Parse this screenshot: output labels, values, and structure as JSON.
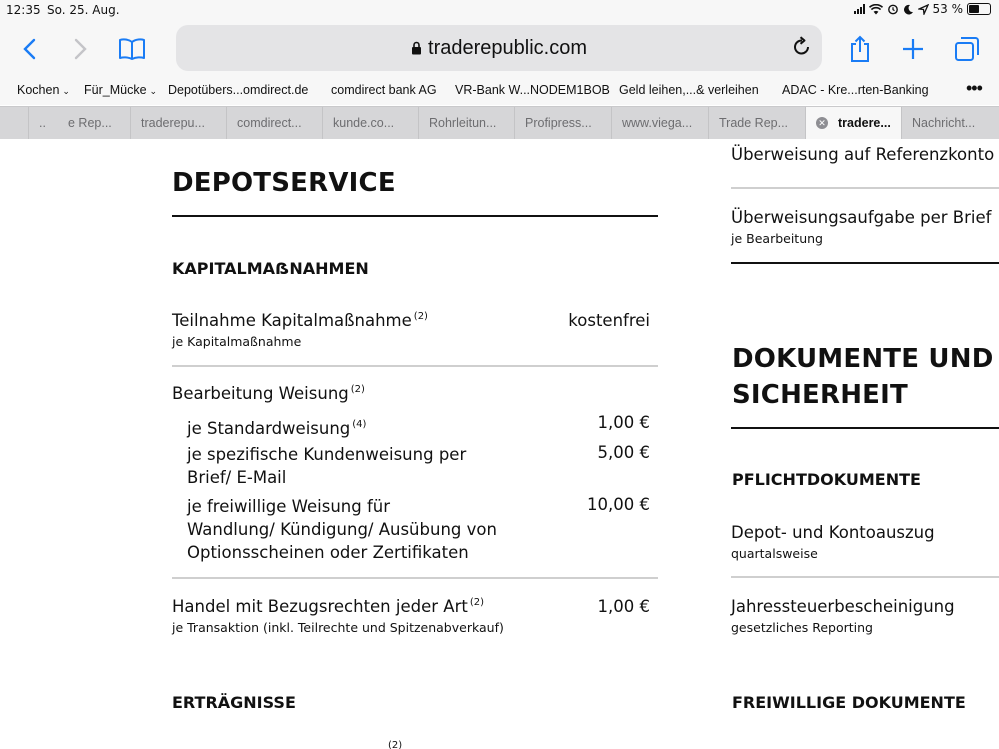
{
  "status_bar": {
    "time": "12:35",
    "date": "So. 25. Aug.",
    "battery": "53 %"
  },
  "toolbar": {
    "url": "traderepublic.com"
  },
  "bookmarks": [
    {
      "label": "Kochen",
      "folder": true
    },
    {
      "label": "Für_Mücke",
      "folder": true
    },
    {
      "label": "Depotübers...omdirect.de",
      "folder": false
    },
    {
      "label": "comdirect bank AG",
      "folder": false
    },
    {
      "label": "VR-Bank W...NODEM1BOB",
      "folder": false
    },
    {
      "label": "Geld leihen,...& verleihen",
      "folder": false
    },
    {
      "label": "ADAC - Kre...rten-Banking",
      "folder": false
    }
  ],
  "tabs": [
    {
      "label": ".."
    },
    {
      "label": "e Rep..."
    },
    {
      "label": "traderepu..."
    },
    {
      "label": "comdirect..."
    },
    {
      "label": "kunde.co..."
    },
    {
      "label": "Rohrleitun..."
    },
    {
      "label": "Profipress..."
    },
    {
      "label": "www.viega..."
    },
    {
      "label": "Trade Rep..."
    },
    {
      "label": "tradere...",
      "active": true
    },
    {
      "label": "Nachricht..."
    }
  ],
  "left": {
    "heading": "DEPOTSERVICE",
    "section": "KAPITALMAẞNAHMEN",
    "rows": {
      "teilnahme": {
        "title": "Teilnahme Kapitalmaßnahme",
        "sup": "(2)",
        "sub": "je Kapitalmaßnahme",
        "price": "kostenfrei"
      },
      "weisung": {
        "title": "Bearbeitung Weisung",
        "sup": "(2)"
      },
      "standard": {
        "text": "je Standardweisung",
        "sup": "(4)",
        "price": "1,00 €"
      },
      "spezifisch": {
        "line1": "je spezifische Kundenweisung per",
        "line2": "Brief/ E-Mail",
        "price": "5,00 €"
      },
      "freiwillig": {
        "line1": "je freiwillige Weisung für",
        "line2": "Wandlung/ Kündigung/ Ausübung von",
        "line3": "Optionsscheinen oder Zertifikaten",
        "price": "10,00 €"
      },
      "handel": {
        "title": "Handel mit Bezugsrechten jeder Art",
        "sup": "(2)",
        "sub": "je Transaktion (inkl. Teilrechte und Spitzenabverkauf)",
        "price": "1,00 €"
      }
    },
    "section2": "ERTRÄGNISSE",
    "partial_sup": "(2)"
  },
  "right": {
    "row_top": "Überweisung auf Referenzkonto",
    "row_brief": {
      "title": "Überweisungsaufgabe per Brief",
      "sub": "je Bearbeitung"
    },
    "heading_line1": "DOKUMENTE UND",
    "heading_line2": "SICHERHEIT",
    "section": "PFLICHTDOKUMENTE",
    "depot": {
      "title": "Depot- und Kontoauszug",
      "sub": "quartalsweise"
    },
    "steuer": {
      "title": "Jahressteuerbescheinigung",
      "sub": "gesetzliches Reporting"
    },
    "section2": "FREIWILLIGE DOKUMENTE"
  }
}
